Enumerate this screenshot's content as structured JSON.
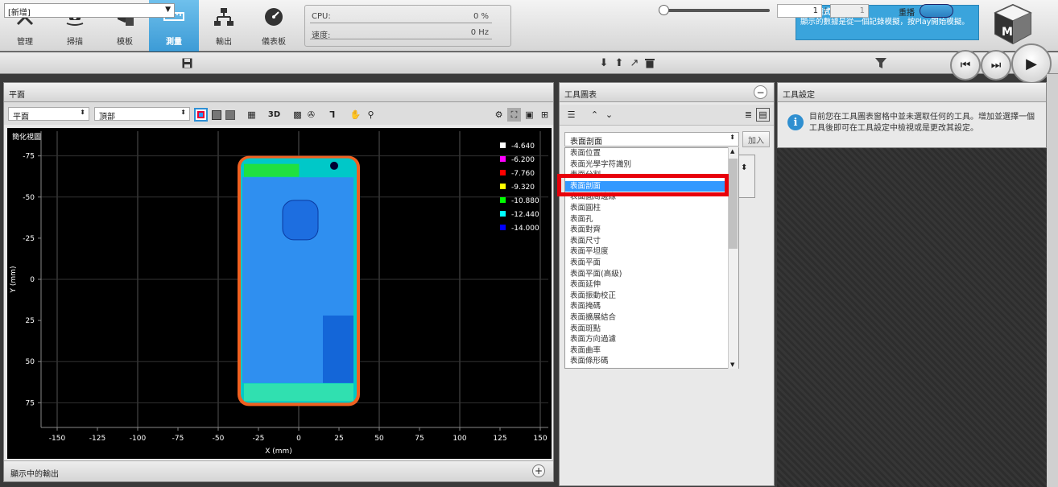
{
  "toolbar": {
    "items": [
      {
        "label": "管理",
        "icon": "tools-icon"
      },
      {
        "label": "掃描",
        "icon": "scan-icon"
      },
      {
        "label": "模板",
        "icon": "cubes-icon"
      },
      {
        "label": "測量",
        "icon": "ruler-icon",
        "active": true
      },
      {
        "label": "輸出",
        "icon": "network-icon"
      },
      {
        "label": "儀表板",
        "icon": "gauge-icon"
      }
    ],
    "cpu_label": "CPU:",
    "cpu_value": "0 %",
    "speed_label": "速度:",
    "speed_value": "0 Hz",
    "replay_title": "重播模式啟動",
    "replay_text": "顯示的數據是從一個記錄模擬，按Play開始模擬。"
  },
  "secondbar": {
    "job": "[新增]",
    "page_current": "1",
    "page_sep": "/",
    "page_total": "1",
    "replay_label": "重播"
  },
  "plane": {
    "title": "平面",
    "view_select": "平面",
    "pos_select": "頂部",
    "btn_3d": "3D",
    "plot_title": "簡化視圖",
    "footer": "顯示中的輸出"
  },
  "chart_data": {
    "type": "heatmap",
    "title": "簡化視圖",
    "xlabel": "X (mm)",
    "ylabel": "Y (mm)",
    "xlim": [
      -160,
      155
    ],
    "ylim": [
      -90,
      90
    ],
    "xticks": [
      -150,
      -125,
      -100,
      -75,
      -50,
      -25,
      0,
      25,
      50,
      75,
      100,
      125,
      150
    ],
    "yticks": [
      -75,
      -50,
      -25,
      0,
      25,
      50,
      75
    ],
    "legend": [
      {
        "value": "-4.640",
        "color": "#ffffff"
      },
      {
        "value": "-6.200",
        "color": "#ff00ff"
      },
      {
        "value": "-7.760",
        "color": "#ff0000"
      },
      {
        "value": "-9.320",
        "color": "#ffff00"
      },
      {
        "value": "-10.880",
        "color": "#00ff00"
      },
      {
        "value": "-12.440",
        "color": "#00ffff"
      },
      {
        "value": "-14.000",
        "color": "#0000ff"
      }
    ],
    "grid": true
  },
  "tool_chart": {
    "title": "工具圖表",
    "selected": "表面剖面",
    "add_label": "加入",
    "options": [
      "表面位置",
      "表面光學字符識別",
      "表面分割",
      "表面剖面",
      "表面圓周邊緣",
      "表面圓柱",
      "表面孔",
      "表面對齊",
      "表面尺寸",
      "表面平坦度",
      "表面平面",
      "表面平面(高級)",
      "表面延伸",
      "表面振動校正",
      "表面掩碼",
      "表面擴展結合",
      "表面斑點",
      "表面方向過濾",
      "表面曲率",
      "表面條形碼"
    ]
  },
  "tool_settings": {
    "title": "工具設定",
    "info": "目前您在工具圖表窗格中並未選取任何的工具。增加並選擇一個工具後即可在工具設定中檢視或是更改其設定。"
  }
}
